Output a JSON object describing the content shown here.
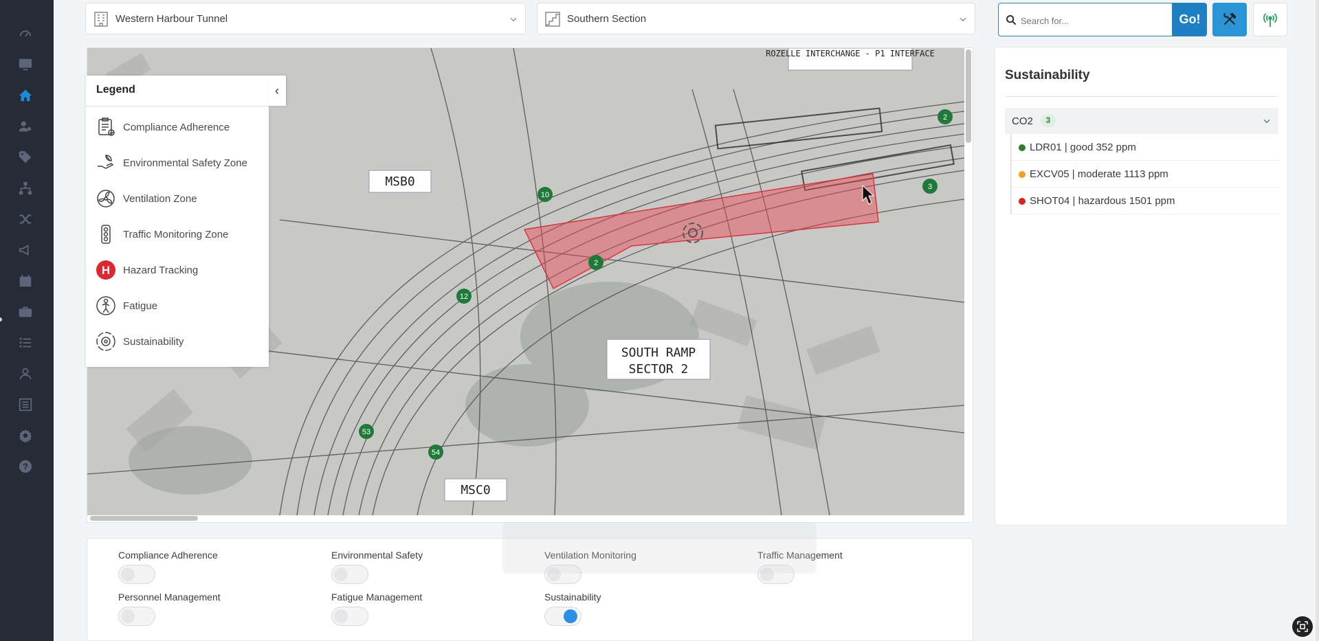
{
  "sidebar": {
    "icons": [
      "speedometer-icon",
      "monitor-icon",
      "home-icon",
      "users-cog-icon",
      "tags-icon",
      "sitemap-icon",
      "shuffle-icon",
      "megaphone-icon",
      "calendar-icon",
      "briefcase-icon",
      "checklist-icon",
      "user-icon",
      "list-icon",
      "gear-icon",
      "help-icon"
    ],
    "active": "home-icon"
  },
  "header": {
    "project_select": "Western Harbour Tunnel",
    "section_select": "Southern Section",
    "search_placeholder": "Search for...",
    "go_label": "Go!"
  },
  "legend": {
    "title": "Legend",
    "collapse": "‹",
    "items": [
      {
        "label": "Compliance Adherence",
        "icon": "clipboard-check-icon"
      },
      {
        "label": "Environmental Safety Zone",
        "icon": "hand-leaf-icon"
      },
      {
        "label": "Ventilation Zone",
        "icon": "fan-icon"
      },
      {
        "label": "Traffic Monitoring Zone",
        "icon": "traffic-light-icon"
      },
      {
        "label": "Hazard Tracking",
        "icon": "hazard-h-icon"
      },
      {
        "label": "Fatigue",
        "icon": "fatigue-worker-icon"
      },
      {
        "label": "Sustainability",
        "icon": "sustainability-cycle-icon"
      }
    ]
  },
  "map": {
    "labels": {
      "interface": "ROZELLE INTERCHANGE - P1 INTERFACE",
      "msbo": "MSB0",
      "msco": "MSC0",
      "ramp_line1": "SOUTH RAMP",
      "ramp_line2": "SECTOR 2"
    },
    "markers": [
      "2",
      "3",
      "10",
      "2",
      "12",
      "53",
      "54"
    ]
  },
  "sustainability_panel": {
    "title": "Sustainability",
    "group": {
      "label": "CO2",
      "count": "3"
    },
    "sensors": [
      {
        "text": "LDR01 | good 352 ppm",
        "color": "#2e7d2e"
      },
      {
        "text": "EXCV05 | moderate 1113 ppm",
        "color": "#f0a020"
      },
      {
        "text": "SHOT04 | hazardous 1501 ppm",
        "color": "#e02020"
      }
    ]
  },
  "toggles": [
    {
      "label": "Compliance Adherence",
      "on": false
    },
    {
      "label": "Environmental Safety",
      "on": false
    },
    {
      "label": "Ventilation Monitoring",
      "on": false
    },
    {
      "label": "Traffic Management",
      "on": false
    },
    {
      "label": "Personnel Management",
      "on": false
    },
    {
      "label": "Fatigue Management",
      "on": false
    },
    {
      "label": "Sustainability",
      "on": true
    }
  ]
}
